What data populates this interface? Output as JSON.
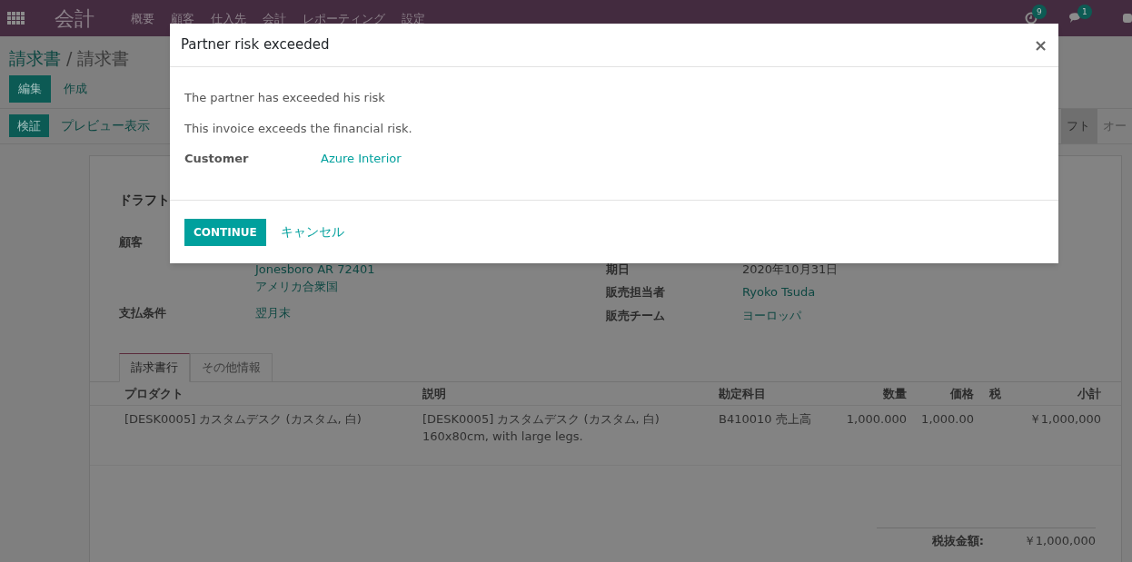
{
  "navbar": {
    "app_title": "会計",
    "menu": [
      "概要",
      "顧客",
      "仕入先",
      "会計",
      "レポーティング",
      "設定"
    ],
    "activity_badge": "9",
    "message_badge": "1"
  },
  "breadcrumb": {
    "parent": "請求書",
    "separator": "/",
    "current": "請求書"
  },
  "buttons": {
    "edit": "編集",
    "create": "作成",
    "validate": "検証",
    "preview": "プレビュー表示"
  },
  "status_steps": [
    {
      "label": "フト",
      "selected": true
    },
    {
      "label": "オー",
      "selected": false
    }
  ],
  "form": {
    "title": "ドラフト",
    "left_fields": [
      {
        "label": "顧客",
        "lines": [
          "Jonesboro AR 72401",
          "アメリカ合衆国"
        ]
      },
      {
        "label": "支払条件",
        "lines": [
          "翌月末"
        ]
      }
    ],
    "right_fields": [
      {
        "label": "期日",
        "value": "2020年10月31日",
        "link": false
      },
      {
        "label": "販売担当者",
        "value": "Ryoko Tsuda",
        "link": true
      },
      {
        "label": "販売チーム",
        "value": "ヨーロッパ",
        "link": true
      }
    ],
    "tabs": [
      {
        "label": "請求書行",
        "selected": true
      },
      {
        "label": "その他情報",
        "selected": false
      }
    ],
    "table": {
      "columns": [
        "プロダクト",
        "説明",
        "勘定科目",
        "数量",
        "価格",
        "税",
        "小計"
      ],
      "rows": [
        {
          "product": "[DESK0005] カスタムデスク (カスタム, 白)",
          "description": [
            "[DESK0005] カスタムデスク (カスタム, 白)",
            "160x80cm, with large legs."
          ],
          "account": "B410010 売上高",
          "quantity": "1,000.000",
          "price": "1,000.00",
          "tax": "",
          "subtotal": "￥1,000,000"
        }
      ]
    },
    "total": {
      "label": "税抜金額:",
      "value": "￥1,000,000"
    }
  },
  "dialog": {
    "title": "Partner risk exceeded",
    "close": "×",
    "messages": [
      "The partner has exceeded his risk",
      "This invoice exceeds the financial risk."
    ],
    "field_label": "Customer",
    "field_value": "Azure Interior",
    "primary_button": "CONTINUE",
    "cancel_button": "キャンセル"
  }
}
